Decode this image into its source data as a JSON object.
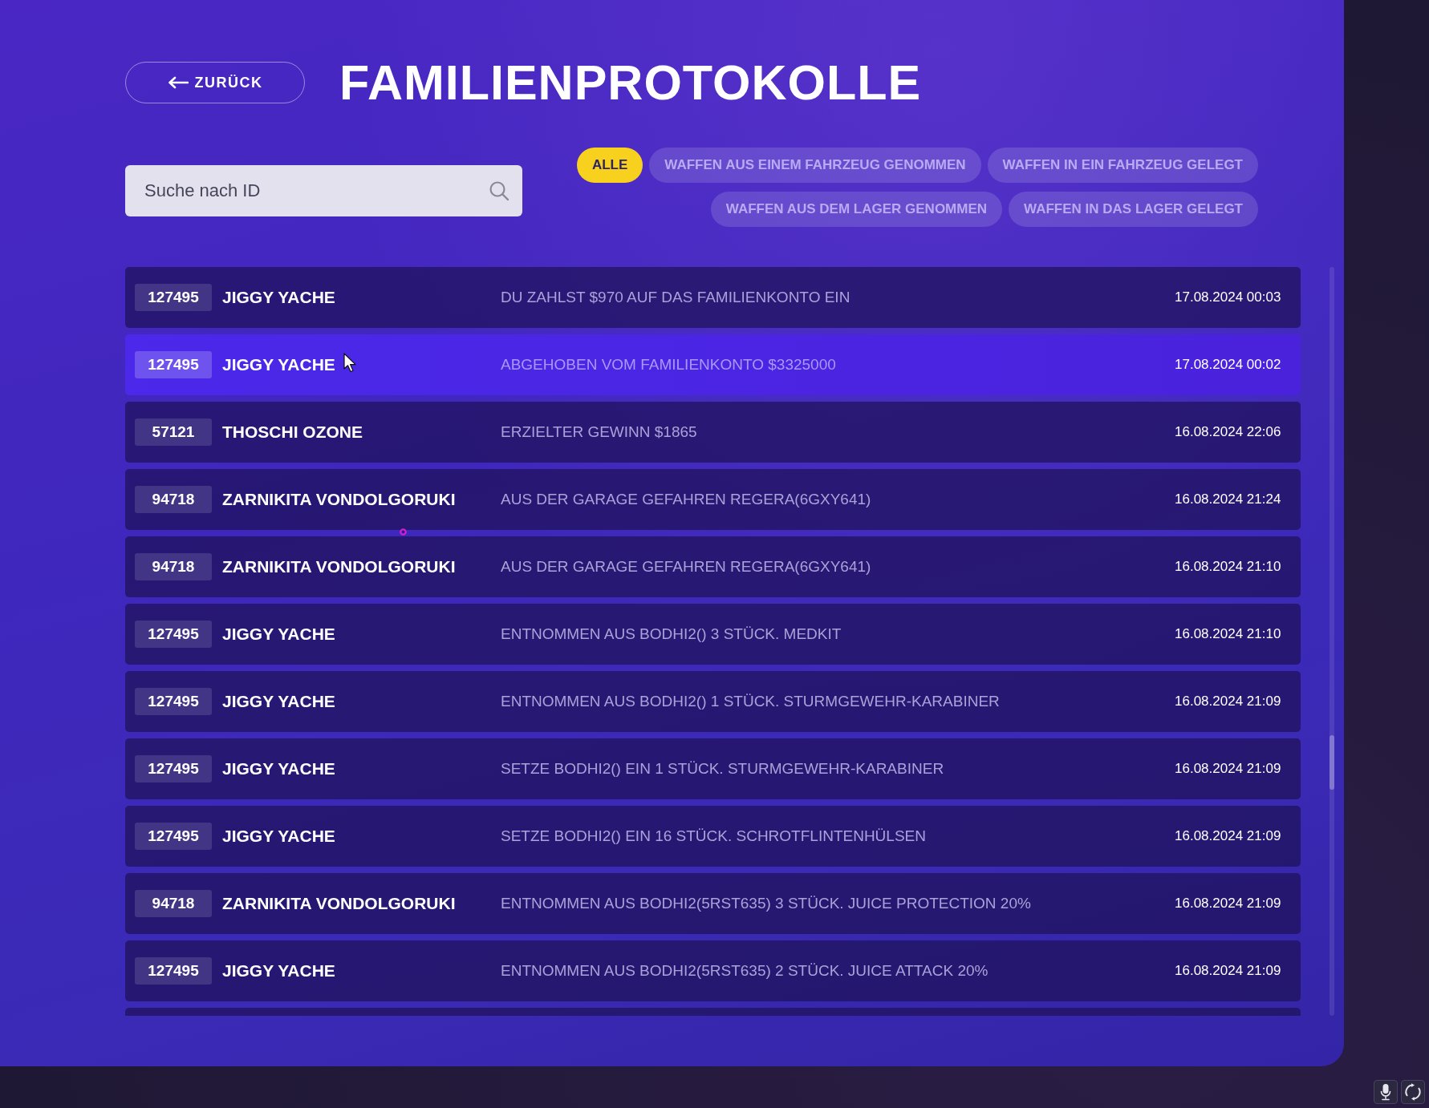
{
  "back_button": {
    "label": "ZURÜCK"
  },
  "title": "FAMILIENPROTOKOLLE",
  "search": {
    "placeholder": "Suche nach ID"
  },
  "filters": [
    {
      "label": "ALLE",
      "selected": true
    },
    {
      "label": "WAFFEN AUS EINEM FAHRZEUG GENOMMEN",
      "selected": false
    },
    {
      "label": "WAFFEN IN EIN FAHRZEUG GELEGT",
      "selected": false
    },
    {
      "label": "WAFFEN AUS DEM LAGER GENOMMEN",
      "selected": false
    },
    {
      "label": "WAFFEN IN DAS LAGER GELEGT",
      "selected": false
    }
  ],
  "logs": [
    {
      "id": "127495",
      "name": "JIGGY YACHE",
      "action": "DU ZAHLST $970 AUF DAS FAMILIENKONTO EIN",
      "time": "17.08.2024 00:03",
      "selected": false
    },
    {
      "id": "127495",
      "name": "JIGGY YACHE",
      "action": "ABGEHOBEN VOM FAMILIENKONTO $3325000",
      "time": "17.08.2024 00:02",
      "selected": true
    },
    {
      "id": "57121",
      "name": "THOSCHI OZONE",
      "action": "ERZIELTER GEWINN $1865",
      "time": "16.08.2024 22:06",
      "selected": false
    },
    {
      "id": "94718",
      "name": "ZARNIKITA VONDOLGORUKI",
      "action": "AUS DER GARAGE GEFAHREN REGERA(6GXY641)",
      "time": "16.08.2024 21:24",
      "selected": false
    },
    {
      "id": "94718",
      "name": "ZARNIKITA VONDOLGORUKI",
      "action": "AUS DER GARAGE GEFAHREN REGERA(6GXY641)",
      "time": "16.08.2024 21:10",
      "selected": false
    },
    {
      "id": "127495",
      "name": "JIGGY YACHE",
      "action": "ENTNOMMEN AUS BODHI2() 3 STÜCK. MEDKIT",
      "time": "16.08.2024 21:10",
      "selected": false
    },
    {
      "id": "127495",
      "name": "JIGGY YACHE",
      "action": "ENTNOMMEN AUS BODHI2() 1 STÜCK. STURMGEWEHR-KARABINER",
      "time": "16.08.2024 21:09",
      "selected": false
    },
    {
      "id": "127495",
      "name": "JIGGY YACHE",
      "action": "SETZE BODHI2() EIN 1 STÜCK. STURMGEWEHR-KARABINER",
      "time": "16.08.2024 21:09",
      "selected": false
    },
    {
      "id": "127495",
      "name": "JIGGY YACHE",
      "action": "SETZE BODHI2() EIN 16 STÜCK. SCHROTFLINTENHÜLSEN",
      "time": "16.08.2024 21:09",
      "selected": false
    },
    {
      "id": "94718",
      "name": "ZARNIKITA VONDOLGORUKI",
      "action": "ENTNOMMEN AUS BODHI2(5RST635) 3 STÜCK. JUICE PROTECTION 20%",
      "time": "16.08.2024 21:09",
      "selected": false
    },
    {
      "id": "127495",
      "name": "JIGGY YACHE",
      "action": "ENTNOMMEN AUS BODHI2(5RST635) 2 STÜCK. JUICE ATTACK 20%",
      "time": "16.08.2024 21:09",
      "selected": false
    }
  ]
}
